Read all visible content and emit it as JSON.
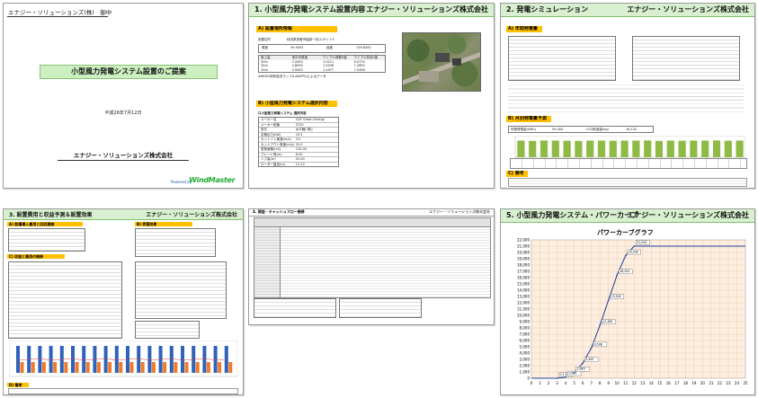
{
  "cover": {
    "recipient": "エナジー・ソリューションズ(株)　御中",
    "title": "小型風力発電システム設置のご提案",
    "date": "平成26年7月12日",
    "company": "エナジー・ソリューションズ株式会社",
    "powered_by": "Powered by",
    "logo_text": "WindMaster"
  },
  "p2": {
    "title": "1. 小型風力発電システム設置内容",
    "company": "エナジー・ソリューションズ株式会社",
    "sec_a": "A) 設置場所情報",
    "address_label": "設置住所",
    "address_value": "秋田県男鹿市船越一向(2)サイト5",
    "lat_label": "緯度",
    "lat_value": "39.9004",
    "lon_label": "経度",
    "lon_value": "139.8492",
    "table_headers": [
      "風上高",
      "地平均風速",
      "ワイブル係数k値",
      "ワイブル形状c値"
    ],
    "table_rows": [
      [
        "50m",
        "5.2000",
        "1.5211",
        "6.0174"
      ],
      [
        "30m",
        "4.8000",
        "1.5036",
        "7.2693"
      ],
      [
        "10m",
        "4.0000",
        "1.4977",
        "7.0496"
      ]
    ],
    "note": "※NEDO局所風況マップ(LAWEPS)によるデータ",
    "sec_b": "B) 小型風力発電システム選択内容",
    "spec_title": "ロ小型風力発電システム 選択内容",
    "spec_rows": [
      [
        "メーカー名",
        "C&F Green Energy"
      ],
      [
        "メーカー型番",
        "CF20"
      ],
      [
        "型式",
        "水平軸(3枚)"
      ],
      [
        "定格出力(kW)",
        "19.5"
      ],
      [
        "カットイン風速(m/s)",
        "3.0"
      ],
      [
        "カットアウト風速(m/s)",
        "25.0"
      ],
      [
        "受風面積(m2)",
        "134.00"
      ],
      [
        "ブレード長(m)",
        "6.50"
      ],
      [
        "ハブ高(m)",
        "20.00"
      ],
      [
        "ローター直径(m)",
        "13.10"
      ]
    ]
  },
  "p3": {
    "title": "2. 発電シミュレーション",
    "company": "エナジー・ソリューションズ株式会社",
    "sec_a": "A) 年間発電量",
    "sec_b": "B) 月別発電量予測",
    "sec_c": "C) 備考",
    "annual_label": "年間発電量(kWh)",
    "annual_value": "59,400",
    "co2_label": "CO2削減量(kg)",
    "co2_value": "18,132",
    "legend": "月別発電量(kWh)"
  },
  "p4": {
    "title": "3. 設置費用と収益予測＆設置効果",
    "company": "エナジー・ソリューションズ株式会社",
    "sec_a": "A) 設備導入費用と回収期間",
    "sec_b": "B) 売電効果",
    "sec_c": "C) 収益と費用の推移",
    "sec_d": "D) 備考"
  },
  "p5": {
    "title": "4. 損益・キャッシュフロー推移",
    "company": "エナジー・ソリューションズ株式会社"
  },
  "p6": {
    "title": "5. 小型風力発電システム・パワーカーブ",
    "company": "エナジー・ソリューションズ株式会社",
    "chart_title": "パワーカーブグラフ"
  },
  "chart_data": [
    {
      "type": "bar",
      "title": "",
      "categories": [
        "1月",
        "2月",
        "3月",
        "4月",
        "5月",
        "6月",
        "7月",
        "8月",
        "9月",
        "10月",
        "11月",
        "12月",
        "1月",
        "2月",
        "3月",
        "4月",
        "5月",
        "6月",
        "7月",
        "8月"
      ],
      "values": [
        5400,
        5300,
        5450,
        5400,
        5350,
        5300,
        5400,
        5400,
        5350,
        5400,
        5400,
        5450,
        5300,
        5400,
        5350,
        5400,
        5400,
        5450,
        5350,
        5400
      ],
      "ylim": [
        0,
        7000
      ],
      "color": "#8fba45"
    },
    {
      "type": "line",
      "title": "パワーカーブグラフ",
      "x": [
        0,
        1,
        2,
        3,
        4,
        5,
        6,
        7,
        8,
        9,
        10,
        11,
        12,
        13,
        14,
        15,
        16,
        17,
        18,
        19,
        20,
        21,
        22,
        23,
        24,
        25
      ],
      "y": [
        0,
        0,
        0,
        0,
        200,
        900,
        2400,
        4800,
        8400,
        12400,
        16400,
        19500,
        21000,
        21000,
        21000,
        21000,
        21000,
        21000,
        21000,
        21000,
        21000,
        21000,
        21000,
        21000,
        21000,
        21000
      ],
      "ylim": [
        0,
        22000
      ],
      "yticks": [
        0,
        1000,
        2000,
        3000,
        4000,
        5000,
        6000,
        7000,
        8000,
        9000,
        10000,
        11000,
        12000,
        13000,
        14000,
        15000,
        16000,
        17000,
        18000,
        19000,
        20000,
        21000,
        22000
      ],
      "xticks": [
        0,
        1,
        2,
        3,
        4,
        5,
        6,
        7,
        8,
        9,
        10,
        11,
        12,
        13,
        14,
        15,
        16,
        17,
        18,
        19,
        20,
        21,
        22,
        23,
        24,
        25
      ],
      "labels": [
        "0.1,56",
        "1,063",
        "2,683",
        "5,400",
        "9,508",
        "12,460",
        "15,040",
        "18,200",
        "20,540",
        "21,000"
      ],
      "grid": true,
      "color": "#1f3d99"
    }
  ]
}
